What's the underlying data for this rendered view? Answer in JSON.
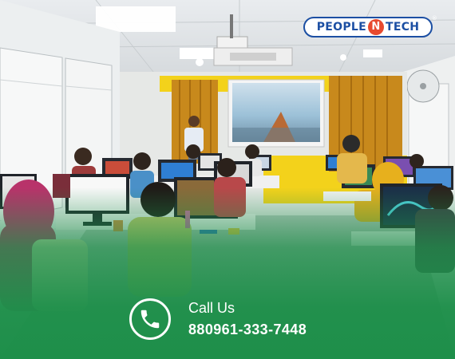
{
  "brand": {
    "left": "PEOPLE",
    "mark": "N",
    "right": "TECH",
    "registered": "®"
  },
  "contact": {
    "label": "Call Us",
    "phone": "880961-333-7448"
  },
  "icons": {
    "phone": "phone-icon",
    "logo": "people-n-tech-logo"
  },
  "colors": {
    "green": "#1e8f4a",
    "brand_blue": "#1c4fa3",
    "brand_orange": "#e84a2f",
    "curtain": "#c8891c",
    "wall_yellow": "#f3d21b"
  }
}
